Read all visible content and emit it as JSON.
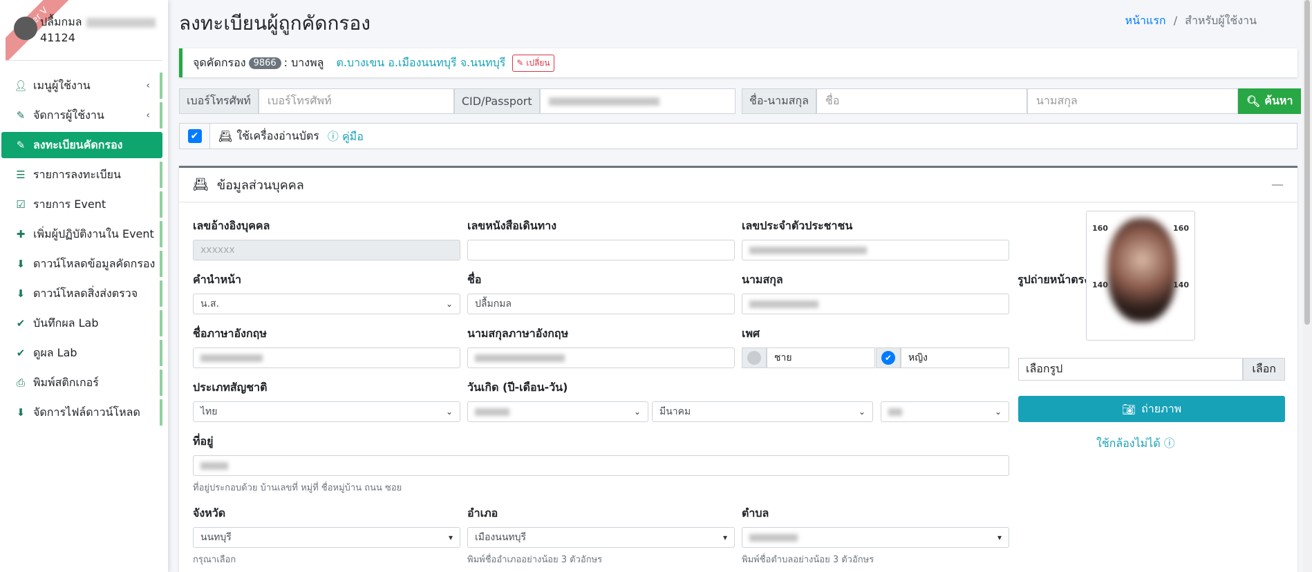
{
  "sidebar": {
    "ribbon": "Server V",
    "user_name": "ปลื้มกมล",
    "user_id": "41124",
    "items": [
      {
        "label": "เมนูผู้ใช้งาน",
        "icon": "user-icon"
      },
      {
        "label": "จัดการผู้ใช้งาน",
        "icon": "user-edit-icon"
      },
      {
        "label": "ลงทะเบียนคัดกรอง",
        "icon": "user-edit-icon"
      },
      {
        "label": "รายการลงทะเบียน",
        "icon": "list-icon"
      },
      {
        "label": "รายการ Event",
        "icon": "calendar-check-icon"
      },
      {
        "label": "เพิ่มผู้ปฏิบัติงานใน Event",
        "icon": "user-plus-icon"
      },
      {
        "label": "ดาวน์โหลดข้อมูลคัดกรอง",
        "icon": "download-icon"
      },
      {
        "label": "ดาวน์โหลดสิ่งส่งตรวจ",
        "icon": "download-icon"
      },
      {
        "label": "บันทึกผล Lab",
        "icon": "clipboard-check-icon"
      },
      {
        "label": "ดูผล Lab",
        "icon": "clipboard-check-icon"
      },
      {
        "label": "พิมพ์สติกเกอร์",
        "icon": "print-icon"
      },
      {
        "label": "จัดการไฟล์ดาวน์โหลด",
        "icon": "download-icon"
      }
    ]
  },
  "header": {
    "title": "ลงทะเบียนผู้ถูกคัดกรอง",
    "breadcrumb_home": "หน้าแรก",
    "breadcrumb_sep": "/",
    "breadcrumb_current": "สำหรับผู้ใช้งาน"
  },
  "callout": {
    "label": "จุดคัดกรอง",
    "badge": "9866",
    "place": ": บางพลู",
    "location": "ต.บางเขน อ.เมืองนนทบุรี จ.นนทบุรี",
    "change": "เปลี่ยน"
  },
  "search": {
    "phone_label": "เบอร์โทรศัพท์",
    "phone_placeholder": "เบอร์โทรศัพท์",
    "cid_label": "CID/Passport",
    "name_label": "ชื่อ-นามสกุล",
    "first_placeholder": "ชื่อ",
    "last_placeholder": "นามสกุล",
    "button": "ค้นหา"
  },
  "reader": {
    "label": "ใช้เครื่องอ่านบัตร",
    "help": "คู่มือ"
  },
  "card": {
    "title": "ข้อมูลส่วนบุคคล",
    "collapse": "—",
    "ref_label": "เลขอ้างอิงบุคคล",
    "ref_value": "xxxxxx",
    "passport_label": "เลขหนังสือเดินทาง",
    "cid_label": "เลขประจำตัวประชาชน",
    "prefix_label": "คำนำหน้า",
    "prefix_value": "น.ส.",
    "fname_label": "ชื่อ",
    "fname_value": "ปลื้มกมล",
    "lname_label": "นามสกุล",
    "en_fname_label": "ชื่อภาษาอังกฤษ",
    "en_lname_label": "นามสกุลภาษาอังกฤษ",
    "sex_label": "เพศ",
    "sex_male": "ชาย",
    "sex_female": "หญิง",
    "nation_label": "ประเภทสัญชาติ",
    "nation_value": "ไทย",
    "dob_label": "วันเกิด (ปี-เดือน-วัน)",
    "dob_month": "มีนาคม",
    "address_label": "ที่อยู่",
    "address_hint": "ที่อยู่ประกอบด้วย บ้านเลขที่ หมู่ที่ ชื่อหมู่บ้าน ถนน ซอย",
    "province_label": "จังหวัด",
    "province_value": "นนทบุรี",
    "province_hint": "กรุณาเลือก",
    "district_label": "อำเภอ",
    "district_value": "เมืองนนทบุรี",
    "district_hint": "พิมพ์ชื่ออำเภออย่างน้อย 3 ตัวอักษร",
    "subdistrict_label": "ตำบล",
    "subdistrict_hint": "พิมพ์ชื่อตำบลอย่างน้อย 3 ตัวอักษร",
    "photo_label": "รูปถ่ายหน้าตรง",
    "photo_marks": [
      "160",
      "160",
      "140",
      "140"
    ],
    "file_placeholder": "เลือกรูป",
    "file_button": "เลือก",
    "snap_button": "ถ่ายภาพ",
    "no_camera": "ใช้กล้องไม่ได้"
  }
}
